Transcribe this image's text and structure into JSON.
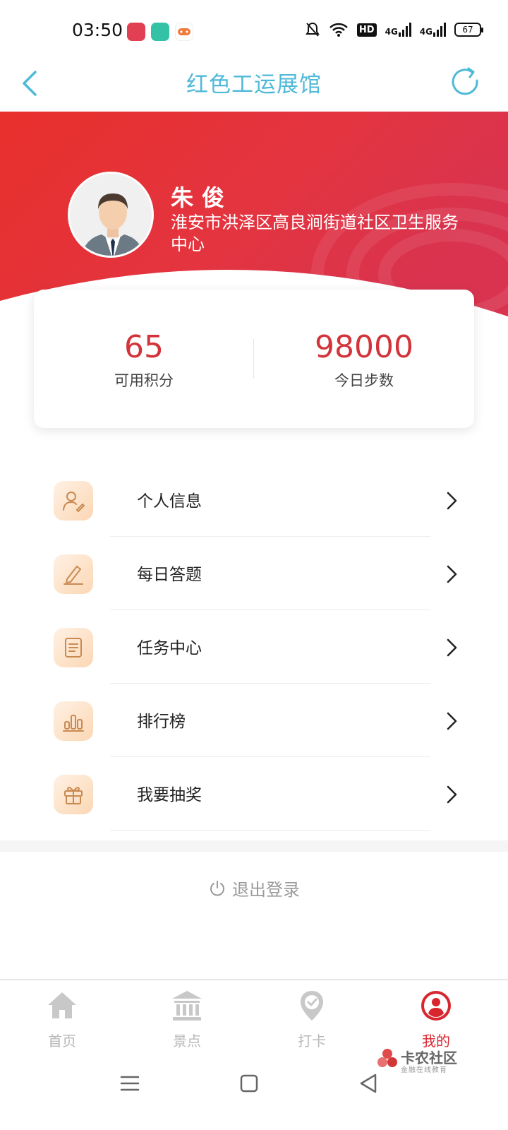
{
  "status_bar": {
    "time": "03:50",
    "signal_1": "4G",
    "signal_2": "4G",
    "hd": "HD",
    "battery": "67"
  },
  "header": {
    "title": "红色工运展馆"
  },
  "profile": {
    "name": "朱俊",
    "organization": "淮安市洪泽区高良涧街道社区卫生服务中心"
  },
  "stats": {
    "points_value": "65",
    "points_label": "可用积分",
    "steps_value": "98000",
    "steps_label": "今日步数"
  },
  "menu": [
    {
      "label": "个人信息",
      "icon": "user-edit-icon"
    },
    {
      "label": "每日答题",
      "icon": "pencil-icon"
    },
    {
      "label": "任务中心",
      "icon": "document-icon"
    },
    {
      "label": "排行榜",
      "icon": "bar-chart-icon"
    },
    {
      "label": "我要抽奖",
      "icon": "gift-icon"
    }
  ],
  "logout": {
    "label": "退出登录"
  },
  "tabs": [
    {
      "label": "首页",
      "icon": "home-icon"
    },
    {
      "label": "景点",
      "icon": "museum-icon"
    },
    {
      "label": "打卡",
      "icon": "location-check-icon"
    },
    {
      "label": "我的",
      "icon": "profile-icon",
      "active": true
    }
  ],
  "watermark": {
    "title": "卡农社区",
    "subtitle": "金融在线教育"
  },
  "colors": {
    "accent_red": "#d8262f",
    "title_blue": "#4fb9d8",
    "icon_orange": "#c98a52"
  }
}
